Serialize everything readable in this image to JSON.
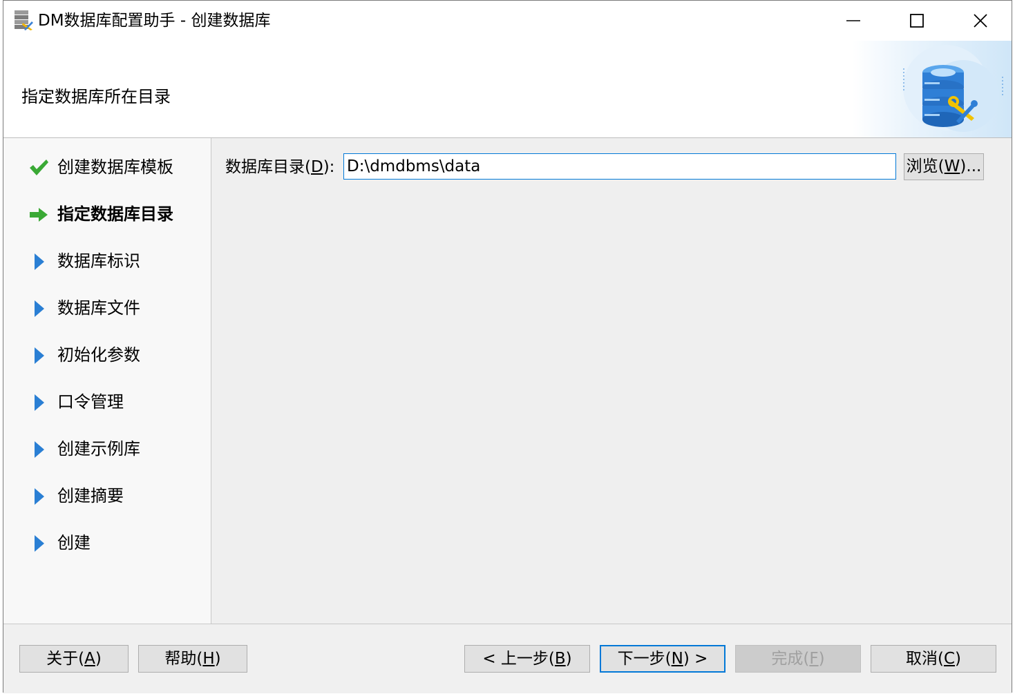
{
  "window": {
    "title": "DM数据库配置助手 - 创建数据库",
    "icons": {
      "app": "database-wizard-icon",
      "minimize": "minimize-icon",
      "maximize": "maximize-icon",
      "close": "close-icon"
    }
  },
  "banner": {
    "title": "指定数据库所在目录",
    "art": "database-tools-icon",
    "colors": {
      "db_blue": "#2f7fd6",
      "tool_yellow": "#f2c200"
    }
  },
  "steps": [
    {
      "label": "创建数据库模板",
      "state": "done",
      "icon": "checkmark-icon"
    },
    {
      "label": "指定数据库目录",
      "state": "current",
      "icon": "arrow-right-icon"
    },
    {
      "label": "数据库标识",
      "state": "pending",
      "icon": "triangle-right-icon"
    },
    {
      "label": "数据库文件",
      "state": "pending",
      "icon": "triangle-right-icon"
    },
    {
      "label": "初始化参数",
      "state": "pending",
      "icon": "triangle-right-icon"
    },
    {
      "label": "口令管理",
      "state": "pending",
      "icon": "triangle-right-icon"
    },
    {
      "label": "创建示例库",
      "state": "pending",
      "icon": "triangle-right-icon"
    },
    {
      "label": "创建摘要",
      "state": "pending",
      "icon": "triangle-right-icon"
    },
    {
      "label": "创建",
      "state": "pending",
      "icon": "triangle-right-icon"
    }
  ],
  "content": {
    "dir_label_pre": "数据库目录(",
    "dir_label_key": "D",
    "dir_label_post": "):",
    "dir_value": "D:\\dmdbms\\data",
    "browse_pre": "浏览(",
    "browse_key": "W",
    "browse_post": ")..."
  },
  "footer": {
    "about": {
      "pre": "关于(",
      "key": "A",
      "post": ")"
    },
    "help": {
      "pre": "帮助(",
      "key": "H",
      "post": ")"
    },
    "prev": {
      "pre": "< 上一步(",
      "key": "B",
      "post": ")"
    },
    "next": {
      "pre": "下一步(",
      "key": "N",
      "post": ") >"
    },
    "finish": {
      "pre": "完成(",
      "key": "F",
      "post": ")"
    },
    "cancel": {
      "pre": "取消(",
      "key": "C",
      "post": ")"
    }
  },
  "colors": {
    "check_green": "#3aa935",
    "arrow_green": "#3aa935",
    "triangle_blue": "#2a7fd4",
    "focus_blue": "#0078d7"
  }
}
